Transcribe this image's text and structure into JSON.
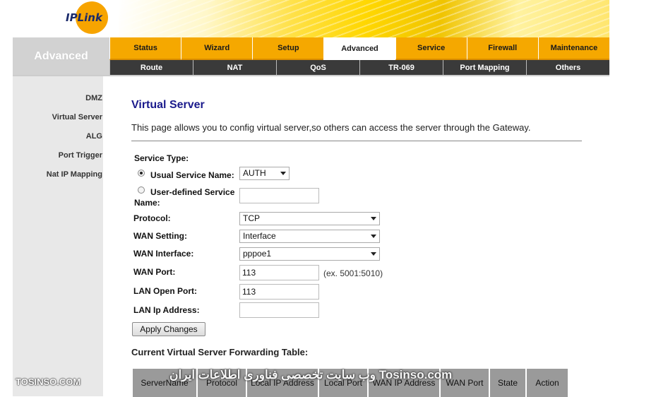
{
  "brand": {
    "logo_text": "IPLink"
  },
  "section_title": "Advanced",
  "tabs": [
    {
      "label": "Status"
    },
    {
      "label": "Wizard"
    },
    {
      "label": "Setup"
    },
    {
      "label": "Advanced",
      "active": true
    },
    {
      "label": "Service"
    },
    {
      "label": "Firewall"
    },
    {
      "label": "Maintenance"
    }
  ],
  "subtabs": [
    {
      "label": "Route"
    },
    {
      "label": "NAT"
    },
    {
      "label": "QoS"
    },
    {
      "label": "TR-069"
    },
    {
      "label": "Port Mapping"
    },
    {
      "label": "Others"
    }
  ],
  "sidebar": {
    "items": [
      {
        "label": "DMZ"
      },
      {
        "label": "Virtual Server"
      },
      {
        "label": "ALG"
      },
      {
        "label": "Port Trigger"
      },
      {
        "label": "Nat IP Mapping"
      }
    ]
  },
  "page": {
    "title": "Virtual Server",
    "description": "This page allows you to config virtual server,so others can access the server through the Gateway."
  },
  "form": {
    "service_type_label": "Service Type:",
    "usual_service_label": "Usual Service Name:",
    "usual_service_value": "AUTH",
    "user_defined_label_1": "User-defined Service",
    "user_defined_label_2": "Name:",
    "user_defined_value": "",
    "protocol_label": "Protocol:",
    "protocol_value": "TCP",
    "wan_setting_label": "WAN Setting:",
    "wan_setting_value": "Interface",
    "wan_interface_label": "WAN Interface:",
    "wan_interface_value": "pppoe1",
    "wan_port_label": "WAN Port:",
    "wan_port_value": "113",
    "wan_port_hint": "(ex. 5001:5010)",
    "lan_open_port_label": "LAN Open Port:",
    "lan_open_port_value": "113",
    "lan_ip_label": "LAN Ip Address:",
    "lan_ip_value": "",
    "apply_label": "Apply Changes"
  },
  "table": {
    "title": "Current Virtual Server Forwarding Table:",
    "columns": [
      "ServerName",
      "Protocol",
      "Local IP Address",
      "Local Port",
      "WAN IP Address",
      "WAN Port",
      "State",
      "Action"
    ]
  },
  "watermarks": {
    "left": "TOSINSO.COM",
    "center": "وب سایت تخصصی فناوری اطلاعات ایران Tosinso.com"
  }
}
